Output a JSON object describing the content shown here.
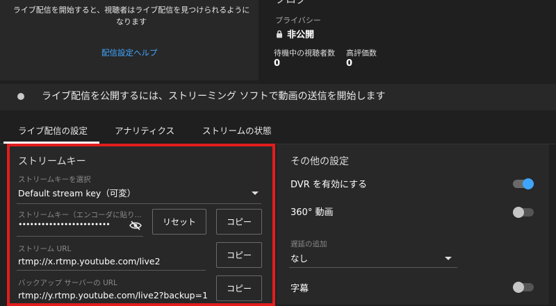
{
  "top": {
    "truncated_heading": "ブログ",
    "preview_message": "ライブ配信を開始すると、視聴者はライブ配信を見つけられるようになります",
    "help_link": "配信設定ヘルプ",
    "privacy_label": "プライバシー",
    "privacy_value": "非公開",
    "waiting_viewers_label": "待機中の視聴者数",
    "waiting_viewers_value": "0",
    "likes_label": "高評価数",
    "likes_value": "0"
  },
  "status": {
    "text": "ライブ配信を公開するには、ストリーミング ソフトで動画の送信を開始します"
  },
  "tabs": [
    {
      "label": "ライブ配信の設定",
      "active": true
    },
    {
      "label": "アナリティクス",
      "active": false
    },
    {
      "label": "ストリームの状態",
      "active": false
    }
  ],
  "stream_key": {
    "section_title": "ストリームキー",
    "select_label": "ストリームキーを選択",
    "select_value": "Default stream key（可変）",
    "key_label": "ストリームキー（エンコーダに貼り...",
    "key_value": "••••••••••••••••••••••••",
    "reset_button": "リセット",
    "copy_button": "コピー",
    "url_label": "ストリーム URL",
    "url_value": "rtmp://x.rtmp.youtube.com/live2",
    "backup_label": "バックアップ サーバーの URL",
    "backup_value": "rtmp://y.rtmp.youtube.com/live2?backup=1"
  },
  "other_settings": {
    "section_title": "その他の設定",
    "dvr_label": "DVR を有効にする",
    "dvr_on": true,
    "video360_label": "360° 動画",
    "video360_on": false,
    "latency_label": "遅延の追加",
    "latency_value": "なし",
    "captions_label": "字幕",
    "captions_on": false
  },
  "colors": {
    "accent": "#3ea6ff",
    "highlight_frame": "#e11d1d",
    "panel": "#282828",
    "background": "#1f1f1f"
  }
}
